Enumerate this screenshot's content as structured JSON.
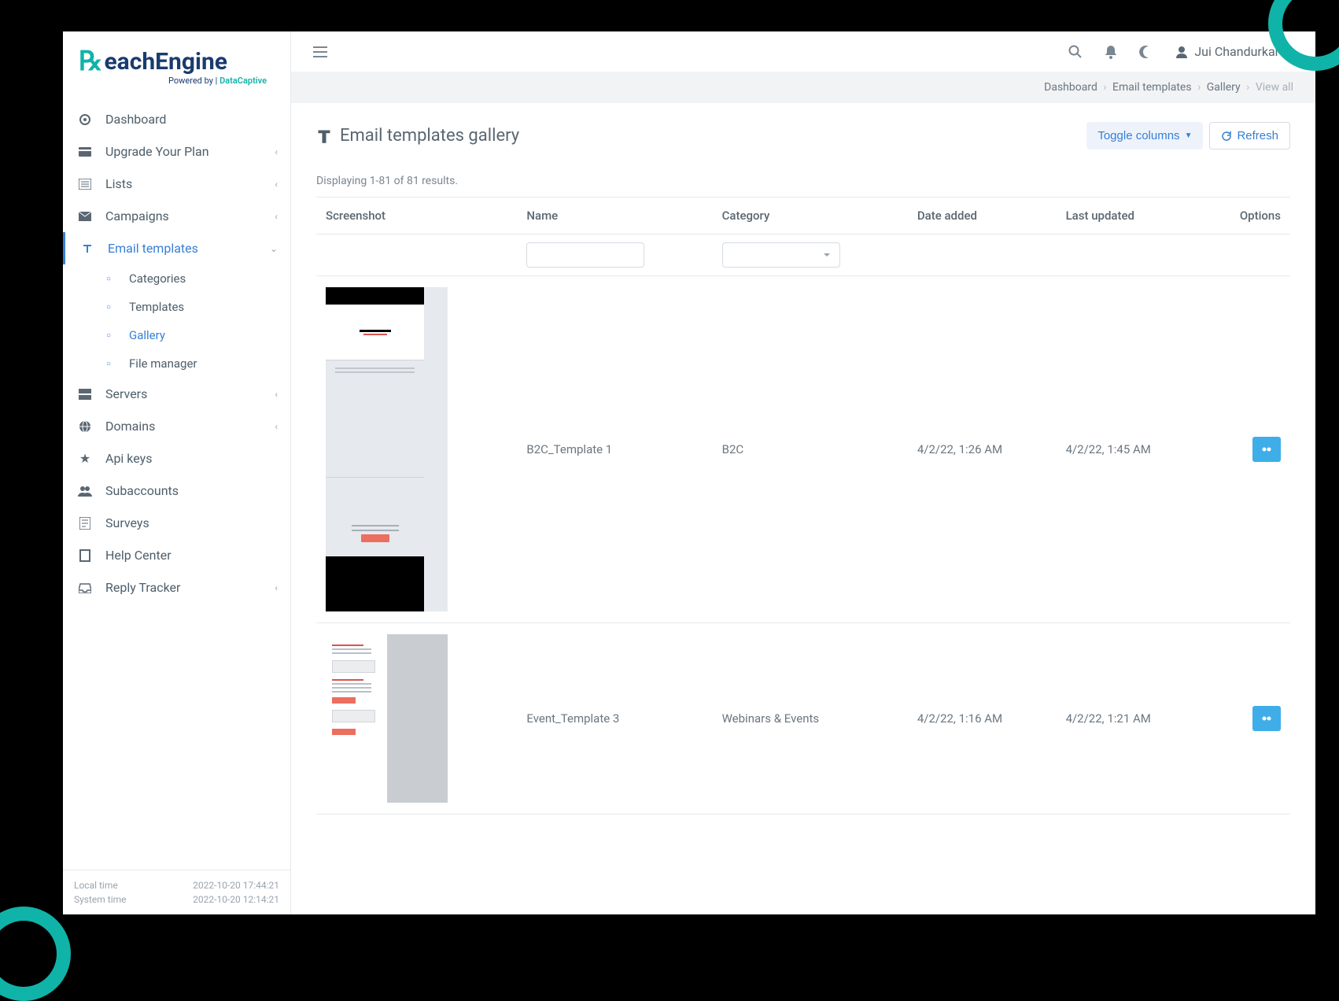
{
  "brand": {
    "name": "ReachEngine",
    "powered_by": "Powered by",
    "partner": "DataCaptive"
  },
  "sidebar": {
    "items": [
      {
        "label": "Dashboard",
        "icon": "dashboard",
        "chevron": null
      },
      {
        "label": "Upgrade Your Plan",
        "icon": "card",
        "chevron": "left"
      },
      {
        "label": "Lists",
        "icon": "list",
        "chevron": "left"
      },
      {
        "label": "Campaigns",
        "icon": "mail",
        "chevron": "left"
      },
      {
        "label": "Email templates",
        "icon": "text",
        "chevron": "down",
        "active": true
      },
      {
        "label": "Servers",
        "icon": "servers",
        "chevron": "left"
      },
      {
        "label": "Domains",
        "icon": "globe",
        "chevron": "left"
      },
      {
        "label": "Api keys",
        "icon": "star",
        "chevron": null
      },
      {
        "label": "Subaccounts",
        "icon": "users",
        "chevron": null
      },
      {
        "label": "Surveys",
        "icon": "survey",
        "chevron": null
      },
      {
        "label": "Help Center",
        "icon": "help",
        "chevron": null
      },
      {
        "label": "Reply Tracker",
        "icon": "inbox",
        "chevron": "left"
      }
    ],
    "sub_items": [
      {
        "label": "Categories"
      },
      {
        "label": "Templates"
      },
      {
        "label": "Gallery",
        "active": true
      },
      {
        "label": "File manager"
      }
    ],
    "time": {
      "local_label": "Local time",
      "local_value": "2022-10-20 17:44:21",
      "system_label": "System time",
      "system_value": "2022-10-20 12:14:21"
    }
  },
  "topbar": {
    "user_name": "Jui Chandurkar"
  },
  "breadcrumb": {
    "items": [
      "Dashboard",
      "Email templates",
      "Gallery",
      "View all"
    ]
  },
  "page": {
    "title": "Email templates gallery",
    "toggle_columns": "Toggle columns",
    "refresh": "Refresh",
    "results_text": "Displaying 1-81 of 81 results."
  },
  "table": {
    "headers": [
      "Screenshot",
      "Name",
      "Category",
      "Date added",
      "Last updated",
      "Options"
    ],
    "rows": [
      {
        "name": "B2C_Template 1",
        "category": "B2C",
        "date_added": "4/2/22, 1:26 AM",
        "last_updated": "4/2/22, 1:45 AM"
      },
      {
        "name": "Event_Template 3",
        "category": "Webinars & Events",
        "date_added": "4/2/22, 1:16 AM",
        "last_updated": "4/2/22, 1:21 AM"
      }
    ]
  }
}
